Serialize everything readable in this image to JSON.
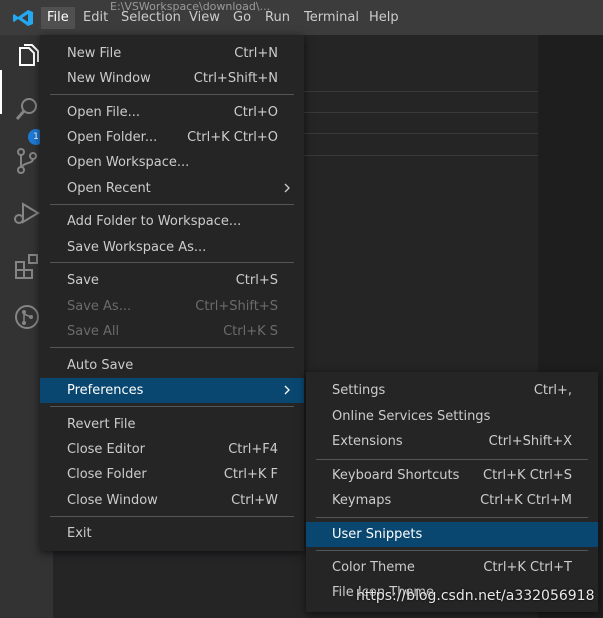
{
  "title_text": "E:\\VSWorkspace\\download\\...",
  "menubar": [
    {
      "label": "File"
    },
    {
      "label": "Edit"
    },
    {
      "label": "Selection"
    },
    {
      "label": "View"
    },
    {
      "label": "Go"
    },
    {
      "label": "Run"
    },
    {
      "label": "Terminal"
    },
    {
      "label": "Help"
    }
  ],
  "badge": "1",
  "file_menu": [
    {
      "label": "New File",
      "shortcut": "Ctrl+N"
    },
    {
      "label": "New Window",
      "shortcut": "Ctrl+Shift+N"
    },
    {
      "label": "Open File...",
      "shortcut": "Ctrl+O"
    },
    {
      "label": "Open Folder...",
      "shortcut": "Ctrl+K Ctrl+O"
    },
    {
      "label": "Open Workspace...",
      "shortcut": ""
    },
    {
      "label": "Open Recent",
      "shortcut": ""
    },
    {
      "label": "Add Folder to Workspace...",
      "shortcut": ""
    },
    {
      "label": "Save Workspace As...",
      "shortcut": ""
    },
    {
      "label": "Save",
      "shortcut": "Ctrl+S"
    },
    {
      "label": "Save As...",
      "shortcut": "Ctrl+Shift+S"
    },
    {
      "label": "Save All",
      "shortcut": "Ctrl+K S"
    },
    {
      "label": "Auto Save",
      "shortcut": ""
    },
    {
      "label": "Preferences",
      "shortcut": ""
    },
    {
      "label": "Revert File",
      "shortcut": ""
    },
    {
      "label": "Close Editor",
      "shortcut": "Ctrl+F4"
    },
    {
      "label": "Close Folder",
      "shortcut": "Ctrl+K F"
    },
    {
      "label": "Close Window",
      "shortcut": "Ctrl+W"
    },
    {
      "label": "Exit",
      "shortcut": ""
    }
  ],
  "preferences_menu": [
    {
      "label": "Settings",
      "shortcut": "Ctrl+,"
    },
    {
      "label": "Online Services Settings",
      "shortcut": ""
    },
    {
      "label": "Extensions",
      "shortcut": "Ctrl+Shift+X"
    },
    {
      "label": "Keyboard Shortcuts",
      "shortcut": "Ctrl+K Ctrl+S"
    },
    {
      "label": "Keymaps",
      "shortcut": "Ctrl+K Ctrl+M"
    },
    {
      "label": "User Snippets",
      "shortcut": ""
    },
    {
      "label": "Color Theme",
      "shortcut": "Ctrl+K Ctrl+T"
    },
    {
      "label": "File Icon Theme",
      "shortcut": ""
    }
  ],
  "watermark": "https://blog.csdn.net/a332056918",
  "colors": {
    "accent": "#094771",
    "logo": "#23a9f2",
    "badge": "#1e7ad6"
  }
}
